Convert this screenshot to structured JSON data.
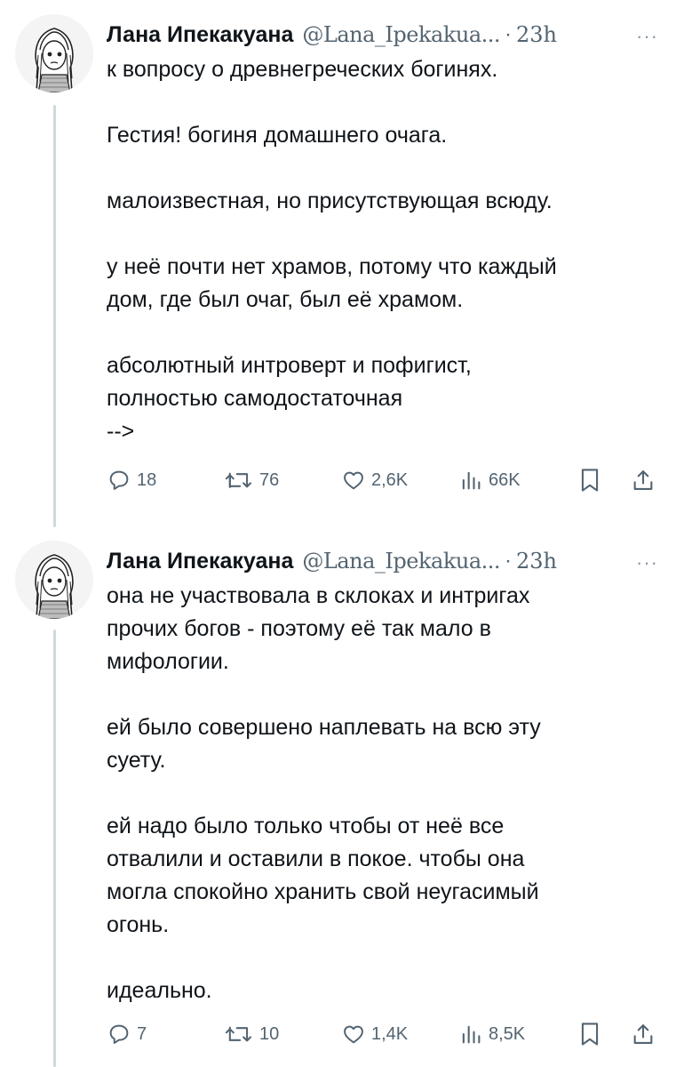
{
  "tweets": [
    {
      "author": {
        "name": "Лана Ипекакуана",
        "handle": "@Lana_Ipekakua...",
        "separator": "·",
        "time": "23h"
      },
      "more_label": "···",
      "paragraphs": [
        [
          "к вопросу о древнегреческих богинях."
        ],
        [
          "Гестия! богиня домашнего очага."
        ],
        [
          "малоизвестная, но присутствующая всюду."
        ],
        [
          "у неё почти нет храмов, потому что каждый",
          "дом, где был очаг, был её храмом."
        ],
        [
          "абсолютный интроверт и пофигист,",
          "полностью самодостаточная",
          "-->"
        ]
      ],
      "stats": {
        "replies": "18",
        "retweets": "76",
        "likes": "2,6K",
        "views": "66K"
      }
    },
    {
      "author": {
        "name": "Лана Ипекакуана",
        "handle": "@Lana_Ipekakua...",
        "separator": "·",
        "time": "23h"
      },
      "more_label": "···",
      "paragraphs": [
        [
          "она не участвовала в склоках и интригах",
          "прочих богов - поэтому её так мало в",
          "мифологии."
        ],
        [
          "ей было совершено наплевать на всю эту",
          "суету."
        ],
        [
          "ей надо было только чтобы от неё все",
          "отвалили и оставили в покое. чтобы она",
          "могла спокойно хранить свой неугасимый",
          "огонь."
        ],
        [
          "идеально."
        ]
      ],
      "stats": {
        "replies": "7",
        "retweets": "10",
        "likes": "1,4K",
        "views": "8,5K"
      }
    }
  ],
  "colors": {
    "text": "#0f1419",
    "secondary": "#536471",
    "thread_line": "#cfd9de"
  },
  "icons": [
    "reply-icon",
    "retweet-icon",
    "like-icon",
    "views-icon",
    "bookmark-icon",
    "share-icon",
    "more-icon"
  ]
}
